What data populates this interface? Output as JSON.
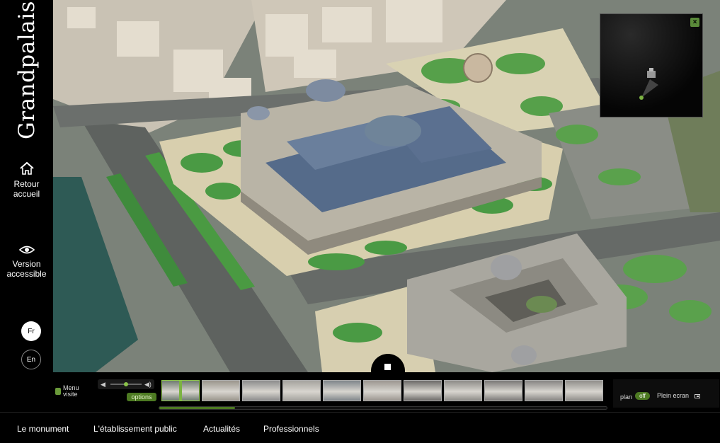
{
  "sidebar": {
    "logo_text": "Grandpalais",
    "home": {
      "label_line1": "Retour",
      "label_line2": "accueil"
    },
    "accessible": {
      "label_line1": "Version",
      "label_line2": "accessible"
    },
    "languages": [
      "Fr",
      "En"
    ],
    "selected_language": "Fr"
  },
  "viewer": {
    "minimap_close": "×",
    "stop_button_icon": "stop-icon"
  },
  "toolbar": {
    "menu_visite_line1": "Menu",
    "menu_visite_line2": "visite",
    "options_label": "options",
    "volume_level": 0.5,
    "thumbnail_count": 11,
    "active_thumbnail": 0,
    "progress_fraction": 0.17,
    "plan_label": "plan",
    "plan_toggle": "off",
    "fullscreen_label": "Plein ecran"
  },
  "footer": {
    "nav": [
      "Le monument",
      "L'établissement public",
      "Actualités",
      "Professionnels"
    ]
  },
  "colors": {
    "accent_green": "#4d7a22",
    "background": "#000000"
  }
}
